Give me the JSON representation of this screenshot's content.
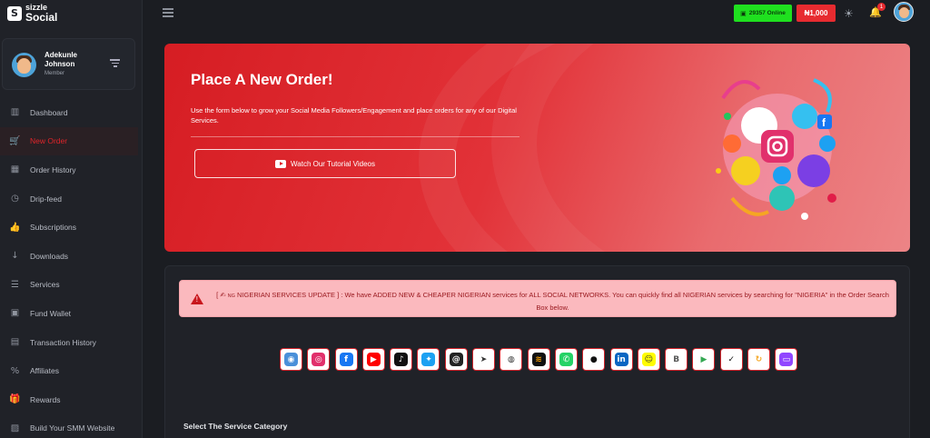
{
  "brand": {
    "line1": "sizzle",
    "line2": "Social"
  },
  "user": {
    "name": "Adekunle Johnson",
    "role": "Member"
  },
  "nav": [
    {
      "label": "Dashboard",
      "icon": "bar-chart-icon",
      "glyph": "▥"
    },
    {
      "label": "New Order",
      "icon": "cart-icon",
      "glyph": "🛒",
      "active": true
    },
    {
      "label": "Order History",
      "icon": "calendar-icon",
      "glyph": "▦"
    },
    {
      "label": "Drip-feed",
      "icon": "clock-icon",
      "glyph": "◷"
    },
    {
      "label": "Subscriptions",
      "icon": "thumbs-up-icon",
      "glyph": "👍"
    },
    {
      "label": "Downloads",
      "icon": "arrow-down-icon",
      "glyph": "↓"
    },
    {
      "label": "Services",
      "icon": "list-icon",
      "glyph": "☰"
    },
    {
      "label": "Fund Wallet",
      "icon": "wallet-icon",
      "glyph": "▣"
    },
    {
      "label": "Transaction History",
      "icon": "document-icon",
      "glyph": "▤"
    },
    {
      "label": "Affiliates",
      "icon": "percent-icon",
      "glyph": "%"
    },
    {
      "label": "Rewards",
      "icon": "gift-icon",
      "glyph": "🎁"
    },
    {
      "label": "Build Your SMM Website",
      "icon": "store-icon",
      "glyph": "▨"
    }
  ],
  "topbar": {
    "online": "29357 Online",
    "balance": "₦1,000",
    "notifications": "1"
  },
  "hero": {
    "title": "Place A New Order!",
    "subtitle": "Use the form below to grow your Social Media Followers/Engagement and place orders for any of our Digital Services.",
    "button": "Watch Our Tutorial Videos"
  },
  "alert": {
    "prefix": "[ ",
    "flag": "NG",
    "text": "NIGERIAN SERVICES UPDATE ] : We have ADDED NEW & CHEAPER NIGERIAN services for ALL SOCIAL NETWORKS. You can quickly find all NIGERIAN services by searching for \"NIGERIA\" in the Order Search Box below."
  },
  "platforms": [
    {
      "name": "all-platforms-icon",
      "bg": "#4a90d9",
      "glyph": "◉"
    },
    {
      "name": "instagram-icon",
      "bg": "#e1306c",
      "glyph": "◎"
    },
    {
      "name": "facebook-icon",
      "bg": "#1877f2",
      "glyph": "f"
    },
    {
      "name": "youtube-icon",
      "bg": "#ff0000",
      "glyph": "▶"
    },
    {
      "name": "tiktok-icon",
      "bg": "#111111",
      "glyph": "♪"
    },
    {
      "name": "twitter-icon",
      "bg": "#1da1f2",
      "glyph": "✦"
    },
    {
      "name": "threads-icon",
      "bg": "#222222",
      "glyph": "@"
    },
    {
      "name": "telegram-icon",
      "bg": "#ffffff",
      "glyph": "➤",
      "fg": "#333"
    },
    {
      "name": "podcast-icon",
      "bg": "#ffffff",
      "glyph": "◍",
      "fg": "#333"
    },
    {
      "name": "audiomack-icon",
      "bg": "#111111",
      "glyph": "≋",
      "fg": "#ffa200"
    },
    {
      "name": "whatsapp-icon",
      "bg": "#25d366",
      "glyph": "✆"
    },
    {
      "name": "apple-icon",
      "bg": "#ffffff",
      "glyph": "●",
      "fg": "#111"
    },
    {
      "name": "linkedin-icon",
      "bg": "#0a66c2",
      "glyph": "in"
    },
    {
      "name": "snapchat-icon",
      "bg": "#fffc00",
      "glyph": "☺",
      "fg": "#333"
    },
    {
      "name": "boomplay-icon",
      "bg": "#ffffff",
      "glyph": "B",
      "fg": "#555"
    },
    {
      "name": "google-play-icon",
      "bg": "#ffffff",
      "glyph": "▶",
      "fg": "#34a853"
    },
    {
      "name": "verified-icon",
      "bg": "#ffffff",
      "glyph": "✓",
      "fg": "#111"
    },
    {
      "name": "refresh-icon",
      "bg": "#ffffff",
      "glyph": "↻",
      "fg": "#f5a623"
    },
    {
      "name": "twitch-icon",
      "bg": "#9146ff",
      "glyph": "▭"
    }
  ],
  "form": {
    "category_label": "Select The Service Category"
  }
}
